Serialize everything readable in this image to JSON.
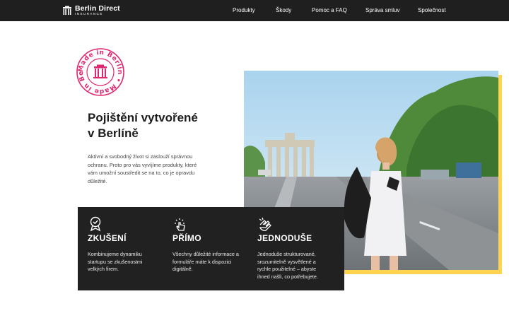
{
  "header": {
    "logo": {
      "name": "Berlin Direct",
      "tagline": "INSURANCE"
    },
    "nav": [
      {
        "label": "Produkty"
      },
      {
        "label": "Škody"
      },
      {
        "label": "Pomoc a FAQ"
      },
      {
        "label": "Správa smluv"
      },
      {
        "label": "Společnost"
      }
    ]
  },
  "stamp": {
    "text": "Made in Berlin • Made in Berlin •",
    "icon": "brandenburg-gate-icon",
    "color": "#e0266f"
  },
  "hero": {
    "title_line1": "Pojištění vytvořené",
    "title_prefix": "v ",
    "title_highlight": "Berlíně",
    "intro": "Aktivní a svobodný život si zaslouží správnou ochranu. Proto pro vás vyvíjíme produkty, které vám umožní soustředit se na to, co je opravdu důležité.",
    "photo": "woman-walking-toward-brandenburg-gate"
  },
  "features": [
    {
      "icon": "award-badge-icon",
      "title": "ZKUŠENÍ",
      "text": "Kombinujeme dynamiku startupu se zkušenostmi velkých firem."
    },
    {
      "icon": "touch-tap-icon",
      "title": "PŘÍMO",
      "text": "Všechny důležité informace a formuláře máte k dispozici digitálně."
    },
    {
      "icon": "hand-gesture-icon",
      "title": "JEDNODUŠE",
      "text": "Jednoduše strukturované, srozumitelně vysvětlené a rychle použitelné – abyste ihned našli, co potřebujete."
    }
  ],
  "colors": {
    "header_bg": "#1f1f1f",
    "accent_yellow": "#ffd95a",
    "stamp_pink": "#e0266f",
    "dark_box": "#212121"
  }
}
